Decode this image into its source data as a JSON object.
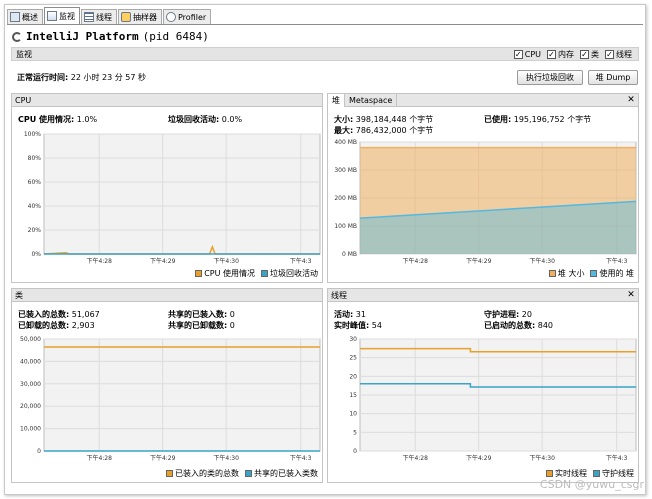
{
  "tabs": [
    {
      "label": "概述",
      "icon": "overview-icon"
    },
    {
      "label": "监视",
      "icon": "monitor-icon"
    },
    {
      "label": "线程",
      "icon": "threads-icon"
    },
    {
      "label": "抽样器",
      "icon": "sampler-icon"
    },
    {
      "label": "Profiler",
      "icon": "profiler-icon"
    }
  ],
  "header": {
    "app": "IntelliJ Platform",
    "pid": "(pid 6484)"
  },
  "monitor_bar": {
    "label": "监视",
    "checks": [
      {
        "label": "CPU",
        "checked": "✓"
      },
      {
        "label": "内存",
        "checked": "✓"
      },
      {
        "label": "类",
        "checked": "✓"
      },
      {
        "label": "线程",
        "checked": "✓"
      }
    ]
  },
  "uptime": {
    "label": "正常运行时间:",
    "value": "22 小时 23 分 57 秒"
  },
  "buttons": {
    "gc": "执行垃圾回收",
    "heap_dump": "堆 Dump"
  },
  "cpu": {
    "title": "CPU",
    "usage_label": "CPU 使用情况:",
    "usage_value": "1.0%",
    "gc_label": "垃圾回收活动:",
    "gc_value": "0.0%",
    "legend": [
      "CPU 使用情况",
      "垃圾回收活动"
    ]
  },
  "heap": {
    "tabs": [
      "堆",
      "Metaspace"
    ],
    "size_label": "大小:",
    "size_value": "398,184,448 个字节",
    "used_label": "已使用:",
    "used_value": "195,196,752 个字节",
    "max_label": "最大:",
    "max_value": "786,432,000 个字节",
    "legend": [
      "堆 大小",
      "使用的 堆"
    ]
  },
  "classes": {
    "title": "类",
    "loaded_label": "已装入的总数:",
    "loaded_value": "51,067",
    "unloaded_label": "已卸载的总数:",
    "unloaded_value": "2,903",
    "shared_loaded_label": "共享的已装入数:",
    "shared_loaded_value": "0",
    "shared_unloaded_label": "共享的已卸载数:",
    "shared_unloaded_value": "0",
    "legend": [
      "已装入的类的总数",
      "共享的已装入类数"
    ]
  },
  "threads": {
    "title": "线程",
    "live_label": "活动:",
    "live_value": "31",
    "peak_label": "实时峰值:",
    "peak_value": "54",
    "daemon_label": "守护进程:",
    "daemon_value": "20",
    "started_label": "已启动的总数:",
    "started_value": "840",
    "legend": [
      "实时线程",
      "守护线程"
    ]
  },
  "chart_data": [
    {
      "type": "line",
      "name": "cpu",
      "ylabels": [
        "100%",
        "80%",
        "60%",
        "40%",
        "20%",
        "0%"
      ],
      "ylim": [
        0,
        100
      ],
      "xlabels": [
        "下午4:28",
        "下午4:29",
        "下午4:30",
        "下午4:3"
      ],
      "series": [
        {
          "name": "CPU 使用情况",
          "color": "#e8a02a",
          "points": [
            [
              0,
              0
            ],
            [
              0.08,
              1
            ],
            [
              0.09,
              0
            ],
            [
              0.6,
              0
            ],
            [
              0.61,
              6
            ],
            [
              0.62,
              0
            ],
            [
              1,
              0
            ]
          ]
        },
        {
          "name": "垃圾回收活动",
          "color": "#3aa3c8",
          "points": [
            [
              0,
              0
            ],
            [
              1,
              0
            ]
          ]
        }
      ]
    },
    {
      "type": "area",
      "name": "heap",
      "ylabels": [
        "400 MB",
        "300 MB",
        "200 MB",
        "100 MB",
        "0 MB"
      ],
      "ylim": [
        0,
        400
      ],
      "xlabels": [
        "下午4:28",
        "下午4:29",
        "下午4:30",
        "下午4:3"
      ],
      "series": [
        {
          "name": "堆 大小",
          "color": "#f0b060",
          "points": [
            [
              0,
              380
            ],
            [
              1,
              380
            ]
          ]
        },
        {
          "name": "使用的 堆",
          "color": "#54b8e0",
          "points": [
            [
              0,
              128
            ],
            [
              1,
              188
            ]
          ]
        }
      ]
    },
    {
      "type": "line",
      "name": "classes",
      "ylabels": [
        "50,000",
        "40,000",
        "30,000",
        "20,000",
        "10,000",
        "0"
      ],
      "ylim": [
        0,
        55000
      ],
      "xlabels": [
        "下午4:28",
        "下午4:29",
        "下午4:30",
        "下午4:3"
      ],
      "series": [
        {
          "name": "已装入的类的总数",
          "color": "#e8a02a",
          "points": [
            [
              0,
              51067
            ],
            [
              1,
              51067
            ]
          ]
        },
        {
          "name": "共享的已装入类数",
          "color": "#3aa3c8",
          "points": [
            [
              0,
              0
            ],
            [
              1,
              0
            ]
          ]
        }
      ]
    },
    {
      "type": "line",
      "name": "threads",
      "ylabels": [
        "30",
        "25",
        "20",
        "15",
        "10",
        "5",
        "0"
      ],
      "ylim": [
        0,
        35
      ],
      "xlabels": [
        "下午4:28",
        "下午4:29",
        "下午4:30",
        "下午4:3"
      ],
      "series": [
        {
          "name": "实时线程",
          "color": "#e8a02a",
          "points": [
            [
              0,
              32
            ],
            [
              0.4,
              32
            ],
            [
              0.4,
              31
            ],
            [
              1,
              31
            ]
          ]
        },
        {
          "name": "守护线程",
          "color": "#3aa3c8",
          "points": [
            [
              0,
              21
            ],
            [
              0.4,
              21
            ],
            [
              0.4,
              20
            ],
            [
              1,
              20
            ]
          ]
        }
      ]
    }
  ],
  "watermark": "CSDN @yuwu_csgr"
}
